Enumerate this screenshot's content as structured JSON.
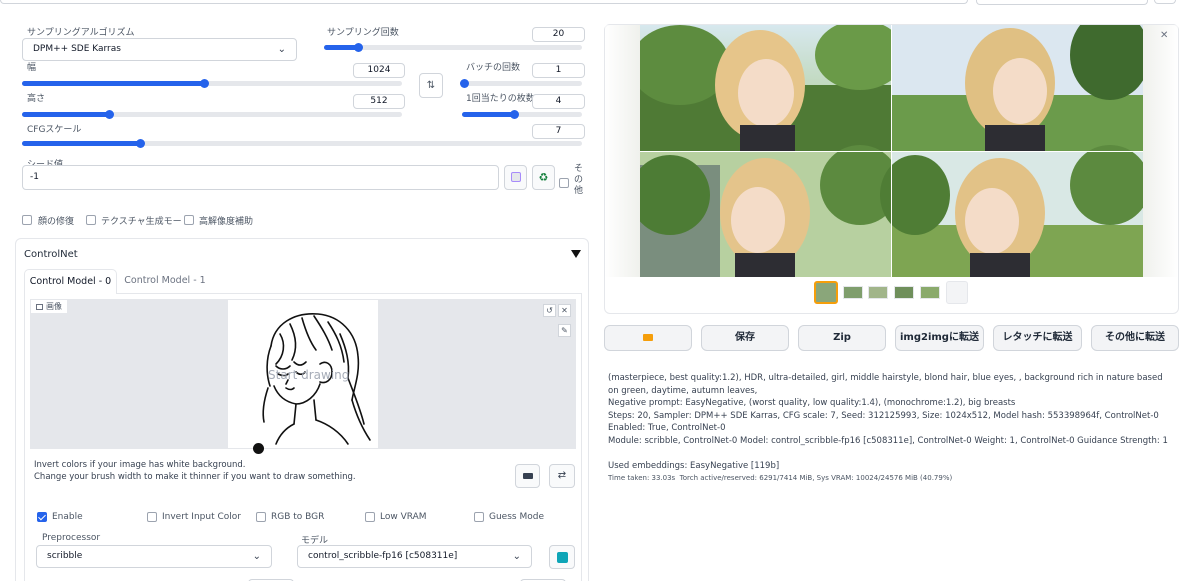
{
  "sampling": {
    "method_label": "サンプリングアルゴリズム",
    "method_value": "DPM++ SDE Karras",
    "steps_label": "サンプリング回数",
    "steps_value": "20",
    "steps_fraction": 0.13
  },
  "size": {
    "width_label": "幅",
    "width_value": "1024",
    "width_fraction": 0.48,
    "height_label": "高さ",
    "height_value": "512",
    "height_fraction": 0.23,
    "swap_icon": "swap-vertical-arrows"
  },
  "batch": {
    "count_label": "バッチの回数",
    "count_value": "1",
    "count_fraction": 0.02,
    "size_label": "1回当たりの枚数",
    "size_value": "4",
    "size_fraction": 0.43
  },
  "cfg": {
    "label": "CFGスケール",
    "value": "7",
    "fraction": 0.21
  },
  "seed": {
    "label": "シード値",
    "value": "-1",
    "dice_icon": "dice-icon",
    "recycle_icon": "recycle-icon",
    "extra_label": "その他"
  },
  "options": {
    "face_restore": "顔の修復",
    "tiling": "テクスチャ生成モード",
    "hires": "高解像度補助"
  },
  "controlnet": {
    "title": "ControlNet",
    "tabs": [
      "Control Model - 0",
      "Control Model - 1"
    ],
    "image_label": "画像",
    "canvas_overlay": "Start drawing",
    "hint_1": "Invert colors if your image has white background.",
    "hint_2": "Change your brush width to make it thinner if you want to draw something.",
    "enable": "Enable",
    "invert": "Invert Input Color",
    "rgb_bgr": "RGB to BGR",
    "low_vram": "Low VRAM",
    "guess_mode": "Guess Mode",
    "preprocessor_label": "Preprocessor",
    "preprocessor_value": "scribble",
    "model_label": "モデル",
    "model_value": "control_scribble-fp16 [c508311e]"
  },
  "gallery": {
    "buttons": {
      "folder_icon": "folder-icon",
      "save": "保存",
      "zip": "Zip",
      "img2img": "img2imgに転送",
      "inpaint": "レタッチに転送",
      "extras": "その他に転送"
    },
    "prompt": "(masterpiece, best quality:1.2), HDR, ultra-detailed, girl, middle hairstyle, blond hair, blue eyes, , background rich in nature based on green, daytime, autumn leaves,",
    "negative": "Negative prompt: EasyNegative, (worst quality, low quality:1.4), (monochrome:1.2), big breasts",
    "params_1": "Steps: 20, Sampler: DPM++ SDE Karras, CFG scale: 7, Seed: 312125993, Size: 1024x512, Model hash: 553398964f, ControlNet-0 Enabled: True, ControlNet-0",
    "params_2": "Module: scribble, ControlNet-0 Model: control_scribble-fp16 [c508311e], ControlNet-0 Weight: 1, ControlNet-0 Guidance Strength: 1",
    "embeddings": "Used embeddings: EasyNegative [119b]",
    "time": "Time taken: 33.03s  Torch active/reserved: 6291/7414 MiB, Sys VRAM: 10024/24576 MiB (40.79%)"
  }
}
